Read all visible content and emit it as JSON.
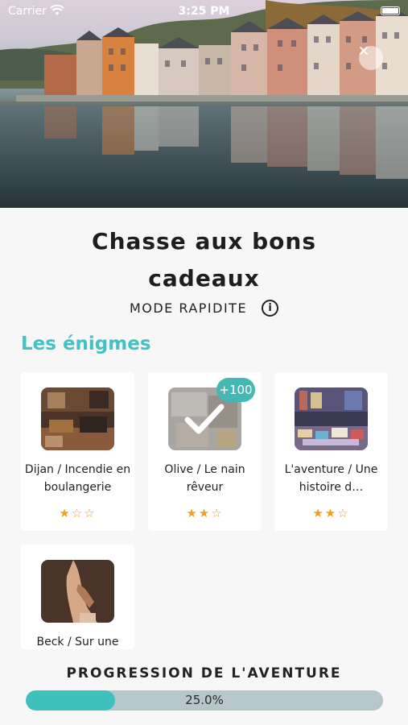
{
  "status_bar": {
    "carrier": "Carrier",
    "time": "3:25 PM"
  },
  "header": {
    "title": "Chasse aux bons cadeaux"
  },
  "mode": {
    "label": "MODE RAPIDITE"
  },
  "section": {
    "title": "Les énigmes"
  },
  "cards": [
    {
      "name": "Dijan / Incendie en boulangerie",
      "stars": "★☆☆",
      "badge": ""
    },
    {
      "name": "Olive / Le nain rêveur",
      "stars": "★★☆",
      "badge": "+100"
    },
    {
      "name": "L'aventure / Une histoire d…",
      "stars": "★★☆",
      "badge": ""
    },
    {
      "name": "Beck / Sur une",
      "stars": "",
      "badge": ""
    }
  ],
  "progress": {
    "label": "PROGRESSION DE L'AVENTURE",
    "text": "25.0%",
    "value": 0.25
  },
  "icons": {
    "close": "close-icon",
    "info": "info-icon",
    "check": "checkmark-icon",
    "wifi": "wifi-icon",
    "battery": "battery-icon"
  },
  "colors": {
    "accent": "#45c0c3",
    "star": "#f0a020",
    "progress_fill": "#3ec1bc",
    "progress_track": "#b7c6ca"
  }
}
